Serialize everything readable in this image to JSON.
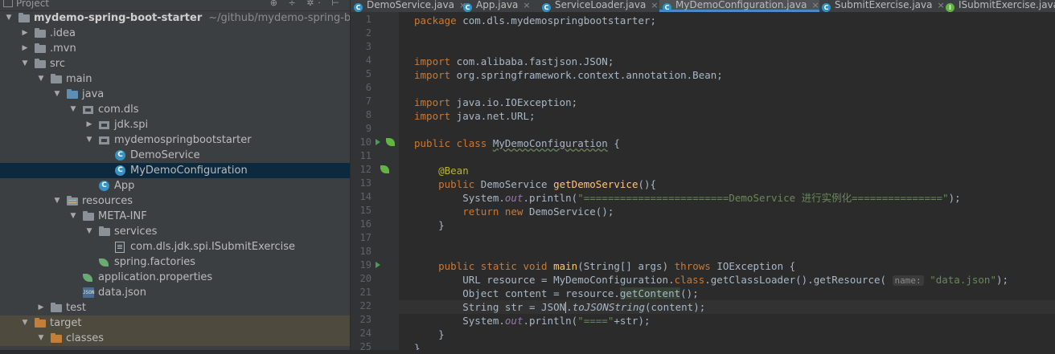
{
  "project_panel": {
    "title": "Project",
    "tools": "⊕ ÷ ✲· ⊢",
    "tree": [
      {
        "label": "mydemo-spring-boot-starter",
        "hint": "~/github/mydemo-spring-boot-s",
        "depth": 0,
        "arrow": "▼",
        "icon": "folder",
        "bold": true
      },
      {
        "label": ".idea",
        "depth": 1,
        "arrow": "▶",
        "icon": "folder"
      },
      {
        "label": ".mvn",
        "depth": 1,
        "arrow": "▶",
        "icon": "folder"
      },
      {
        "label": "src",
        "depth": 1,
        "arrow": "▼",
        "icon": "folder"
      },
      {
        "label": "main",
        "depth": 2,
        "arrow": "▼",
        "icon": "folder"
      },
      {
        "label": "java",
        "depth": 3,
        "arrow": "▼",
        "icon": "folder-src"
      },
      {
        "label": "com.dls",
        "depth": 4,
        "arrow": "▼",
        "icon": "package"
      },
      {
        "label": "jdk.spi",
        "depth": 5,
        "arrow": "▶",
        "icon": "package"
      },
      {
        "label": "mydemospringbootstarter",
        "depth": 5,
        "arrow": "▼",
        "icon": "package"
      },
      {
        "label": "DemoService",
        "depth": 6,
        "arrow": "",
        "icon": "class"
      },
      {
        "label": "MyDemoConfiguration",
        "depth": 6,
        "arrow": "",
        "icon": "class",
        "selected": true
      },
      {
        "label": "App",
        "depth": 5,
        "arrow": "",
        "icon": "class"
      },
      {
        "label": "resources",
        "depth": 3,
        "arrow": "▼",
        "icon": "folder-res"
      },
      {
        "label": "META-INF",
        "depth": 4,
        "arrow": "▼",
        "icon": "folder"
      },
      {
        "label": "services",
        "depth": 5,
        "arrow": "▼",
        "icon": "folder"
      },
      {
        "label": "com.dls.jdk.spi.ISubmitExercise",
        "depth": 6,
        "arrow": "",
        "icon": "file"
      },
      {
        "label": "spring.factories",
        "depth": 5,
        "arrow": "",
        "icon": "spring"
      },
      {
        "label": "application.properties",
        "depth": 4,
        "arrow": "",
        "icon": "spring"
      },
      {
        "label": "data.json",
        "depth": 4,
        "arrow": "",
        "icon": "json"
      },
      {
        "label": "test",
        "depth": 2,
        "arrow": "▶",
        "icon": "folder"
      },
      {
        "label": "target",
        "depth": 1,
        "arrow": "▼",
        "icon": "folder-orange",
        "target": true
      },
      {
        "label": "classes",
        "depth": 2,
        "arrow": "▼",
        "icon": "folder-orange",
        "target": true
      }
    ]
  },
  "tabs": [
    {
      "label": "DemoService.java",
      "icon": "C"
    },
    {
      "label": "App.java",
      "icon": "C"
    },
    {
      "label": "ServiceLoader.java",
      "icon": "C"
    },
    {
      "label": "MyDemoConfiguration.java",
      "icon": "C",
      "active": true
    },
    {
      "label": "SubmitExercise.java",
      "icon": "C"
    },
    {
      "label": "ISubmitExercise.java",
      "icon": "I"
    }
  ],
  "close_glyph": "×",
  "editor": {
    "lines": [
      {
        "n": "1",
        "html": "<span class=\"kw\">package</span> com.dls.mydemospringbootstarter;"
      },
      {
        "n": "2",
        "html": ""
      },
      {
        "n": "3",
        "html": ""
      },
      {
        "n": "4",
        "html": "<span class=\"kw\">import</span> com.alibaba.fastjson.JSON;"
      },
      {
        "n": "5",
        "html": "<span class=\"kw\">import</span> org.springframework.context.annotation.Bean;"
      },
      {
        "n": "6",
        "html": ""
      },
      {
        "n": "7",
        "html": "<span class=\"kw\">import</span> java.io.IOException;"
      },
      {
        "n": "8",
        "html": "<span class=\"kw\">import</span> java.net.URL;"
      },
      {
        "n": "9",
        "html": ""
      },
      {
        "n": "10",
        "html": "<span class=\"kw\">public class</span> <span class=\"underline-typo\">MyDemoConfiguration</span> {",
        "run": true,
        "bean": true
      },
      {
        "n": "11",
        "html": ""
      },
      {
        "n": "12",
        "html": "    <span class=\"an\">@Bean</span>",
        "bean": true
      },
      {
        "n": "13",
        "html": "    <span class=\"kw\">public</span> DemoService <span class=\"fn\">getDemoService</span>(){"
      },
      {
        "n": "14",
        "html": "        System.<span class=\"static\">out</span>.println(<span class=\"str\">\"========================DemoService 进行实例化===============\"</span>);"
      },
      {
        "n": "15",
        "html": "        <span class=\"kw\">return new</span> DemoService();"
      },
      {
        "n": "16",
        "html": "    }"
      },
      {
        "n": "17",
        "html": ""
      },
      {
        "n": "18",
        "html": ""
      },
      {
        "n": "19",
        "html": "    <span class=\"kw\">public static void</span> <span class=\"fn\">main</span>(String[] args) <span class=\"kw\">throws</span> IOException {",
        "run": true
      },
      {
        "n": "20",
        "html": "        URL resource = MyDemoConfiguration.<span class=\"kw\">class</span>.getClassLoader().getResource( <span class=\"hint\">name:</span> <span class=\"str\">\"data.json\"</span>);"
      },
      {
        "n": "21",
        "html": "        Object content = resource.<span class=\"usage-hl\">getContent</span>();"
      },
      {
        "n": "22",
        "html": "        String str = JSON<span class=\"caret\"></span>.<span class=\"italic-fn\">toJSONString</span>(content);",
        "cursor": true
      },
      {
        "n": "23",
        "html": "        System.<span class=\"static\">out</span>.println(<span class=\"str\">\"====\"</span>+str);"
      },
      {
        "n": "24",
        "html": "    }"
      },
      {
        "n": "25",
        "html": "}"
      }
    ]
  }
}
